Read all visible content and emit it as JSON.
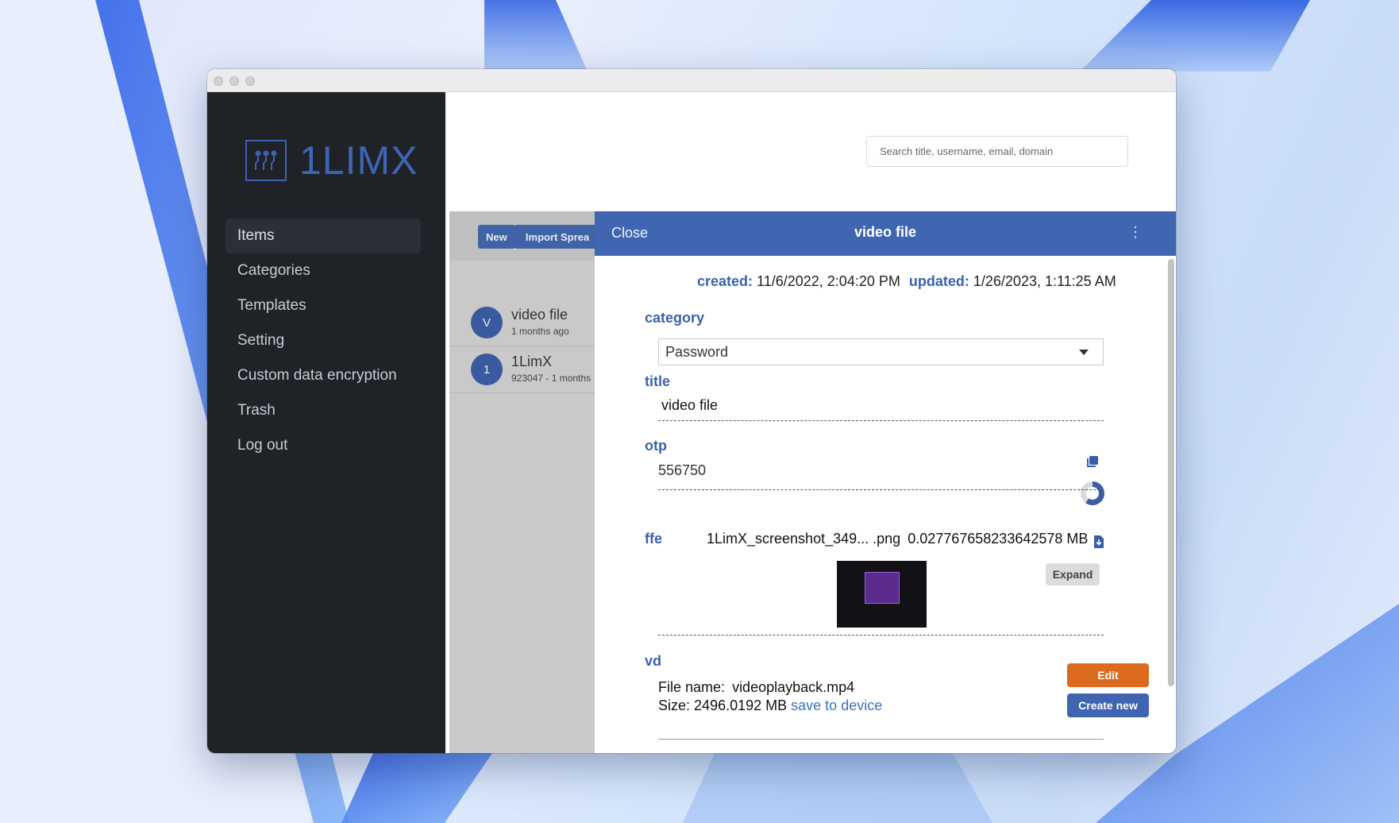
{
  "app": {
    "logo_text": "1LIMX"
  },
  "sidebar": {
    "items": [
      {
        "label": "Items",
        "active": true
      },
      {
        "label": "Categories"
      },
      {
        "label": "Templates"
      },
      {
        "label": "Setting"
      },
      {
        "label": "Custom data encryption"
      },
      {
        "label": "Trash"
      },
      {
        "label": "Log out"
      }
    ]
  },
  "search": {
    "placeholder": "Search title, username, email, domain"
  },
  "toolbar": {
    "new_label": "New",
    "import_label": "Import Sprea"
  },
  "list": {
    "rows": [
      {
        "avatar": "V",
        "title": "video file",
        "subtitle": "1 months ago"
      },
      {
        "avatar": "1",
        "title": "1LimX",
        "subtitle": "923047 - 1 months"
      }
    ]
  },
  "panel": {
    "close_label": "Close",
    "title": "video file",
    "more_icon": "⋮",
    "created_label": "created:",
    "created_value": "11/6/2022, 2:04:20 PM",
    "updated_label": "updated:",
    "updated_value": "1/26/2023, 1:11:25 AM",
    "category_label": "category",
    "category_value": "Password",
    "title_label": "title",
    "title_value": "video file",
    "otp_label": "otp",
    "otp_value": "556750",
    "ffe_label": "ffe",
    "ffe_filename": "1LimX_screenshot_349... .png",
    "ffe_size": "0.027767658233642578 MB",
    "expand_label": "Expand",
    "vd_label": "vd",
    "file_name_label": "File name:",
    "file_name_value": "videoplayback.mp4",
    "size_label": "Size:",
    "size_value": "2496.0192 MB",
    "save_link": "save to device",
    "edit_label": "Edit",
    "create_label": "Create new"
  },
  "colors": {
    "accent": "#4066b1",
    "sidebar_bg": "#1f2328",
    "edit_orange": "#dc6a1e"
  }
}
